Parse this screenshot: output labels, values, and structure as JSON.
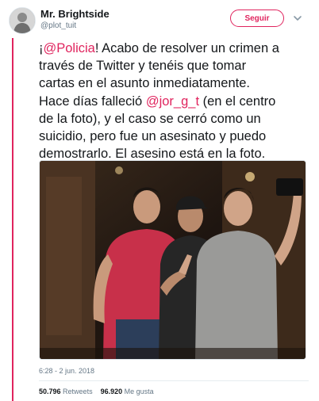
{
  "user": {
    "display_name": "Mr. Brightside",
    "handle": "@plot_tuit",
    "follow_label": "Seguir"
  },
  "tweet": {
    "text_prefix": "¡",
    "mention_1": "@Policia",
    "text_mid": "! Acabo de resolver un crimen a\ntravés de Twitter y tenéis que tomar\ncartas en el asunto inmediatamente.\nHace días falleció ",
    "mention_2": "@jor_g_t",
    "text_suffix": " (en el centro\nde la foto), y el caso se cerró como un\nsuicidio, pero fue un asesinato y puedo\ndemostrarlo. El asesino está en la foto.",
    "timestamp": "6:28 - 2 jun. 2018"
  },
  "stats": {
    "retweets_count": "50.796",
    "retweets_label": "Retweets",
    "likes_count": "96.920",
    "likes_label": "Me gusta"
  },
  "colors": {
    "accent": "#e0245e",
    "text": "#14171a",
    "muted": "#657786"
  },
  "icons": {
    "more": "chevron-down-icon"
  }
}
